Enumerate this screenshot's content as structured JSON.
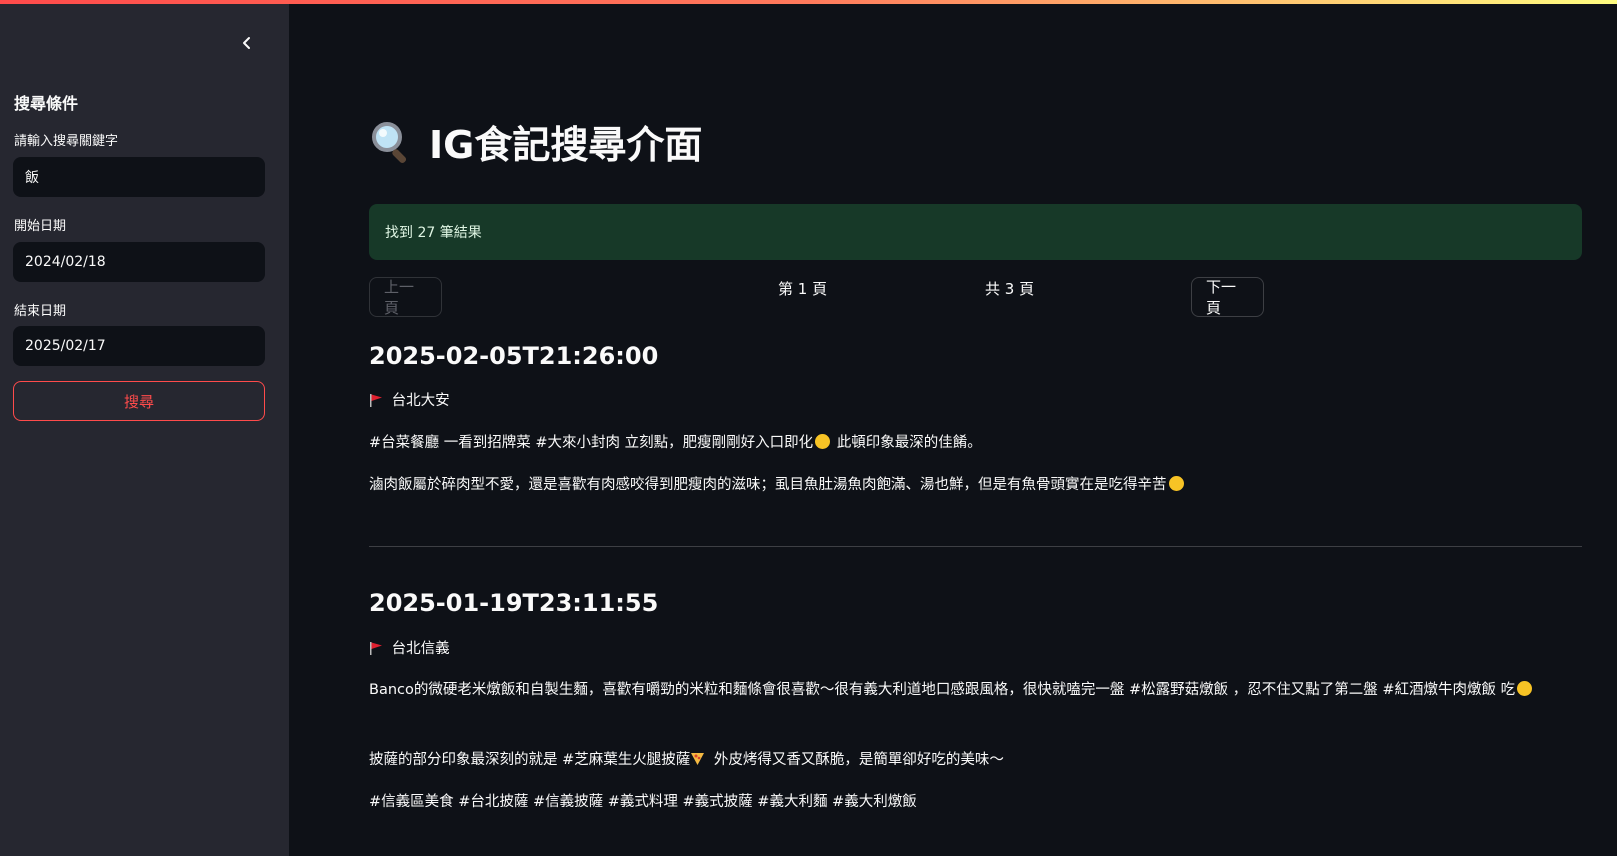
{
  "sidebar": {
    "title": "搜尋條件",
    "keyword_label": "請輸入搜尋關鍵字",
    "keyword_value": "飯",
    "start_label": "開始日期",
    "start_value": "2024/02/18",
    "end_label": "結束日期",
    "end_value": "2025/02/17",
    "search_button": "搜尋"
  },
  "main": {
    "title": "IG食記搜尋介面",
    "result_message": "找到 27 筆結果",
    "prev_button": "上一頁",
    "next_button": "下一頁",
    "page_current": "第 1 頁",
    "page_total": "共 3 頁"
  },
  "posts": [
    {
      "date": "2025-02-05T21:26:00",
      "location": "台北大安",
      "line1_a": "#台菜餐廳 一看到招牌菜 #大來小封肉 立刻點，肥瘦剛剛好入口即化",
      "line1_b": " 此頓印象最深的佳餚。",
      "line2": "滷肉飯屬於碎肉型不愛，還是喜歡有肉感咬得到肥瘦肉的滋味；虱目魚肚湯魚肉飽滿、湯也鮮，但是有魚骨頭實在是吃得辛苦"
    },
    {
      "date": "2025-01-19T23:11:55",
      "location": "台北信義",
      "line1": "Banco的微硬老米燉飯和自製生麵，喜歡有嚼勁的米粒和麵條會很喜歡～很有義大利道地口感跟風格，很快就嗑完一盤 #松露野菇燉飯 ，忍不住又點了第二盤 #紅酒燉牛肉燉飯 吃",
      "line2_a": "披薩的部分印象最深刻的就是 #芝麻葉生火腿披薩",
      "line2_b": " 外皮烤得又香又酥脆，是簡單卻好吃的美味～",
      "line3": "#信義區美食 #台北披薩 #信義披薩 #義式料理 #義式披薩 #義大利麵 #義大利燉飯"
    }
  ],
  "colors": {
    "accent": "#ff4b4b",
    "background": "#0e1117",
    "sidebar_bg": "#262730",
    "success_bg": "#173928"
  },
  "icons": [
    "chevron-left-icon",
    "magnifier-icon",
    "red-flag-icon",
    "smile-emoji-icon",
    "disappointed-emoji-icon",
    "pizza-emoji-icon"
  ]
}
